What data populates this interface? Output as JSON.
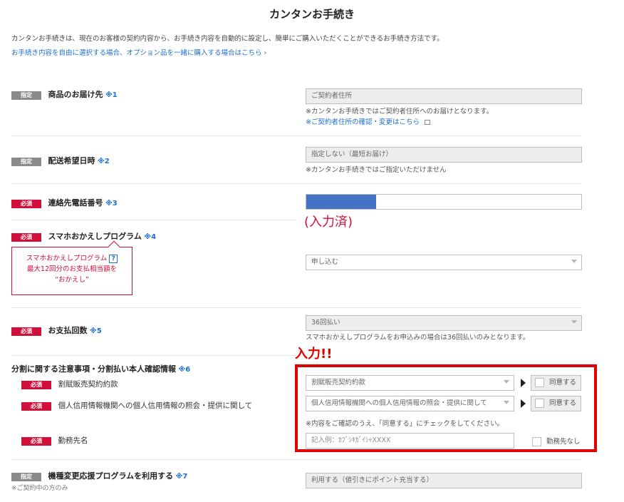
{
  "page": {
    "title": "カンタンお手続き",
    "intro": "カンタンお手続きは、現在のお客様の契約内容から、お手続き内容を自動的に設定し、簡単にご購入いただくことができるお手続き方法です。",
    "intro_link": "お手続き内容を自由に選択する場合、オプション品を一緒に購入する場合はこちら ›"
  },
  "badges": {
    "fixed": "指定",
    "required": "必須"
  },
  "delivery": {
    "label": "商品のお届け先",
    "note": "※1",
    "value": "ご契約者住所",
    "help": "※カンタンお手続きではご契約者住所へのお届けとなります。",
    "link": "※ご契約者住所の確認・変更はこちら"
  },
  "delivery_date": {
    "label": "配送希望日時",
    "note": "※2",
    "value": "指定しない（最短お届け）",
    "help": "※カンタンお手続きではご指定いただけません"
  },
  "phone": {
    "label": "連絡先電話番号",
    "note": "※3",
    "annotation": "(入力済)",
    "filled_color": "#4472c4"
  },
  "kaekae": {
    "label": "スマホおかえしプログラム",
    "note": "※4",
    "promo_line1": "スマホおかえしプログラム",
    "promo_q": "?",
    "promo_line2": "最大12回分のお支払相当額を",
    "promo_line3": "“おかえし”",
    "value": "申し込む"
  },
  "installments": {
    "label": "お支払回数",
    "note": "※5",
    "value": "36回払い",
    "help": "スマホおかえしプログラムをお申込みの場合は36回払いのみとなります。"
  },
  "installment_terms": {
    "annotation": "入力!!",
    "label": "分割に関する注意事項・分割払い本人確認情報",
    "note": "※6",
    "row1_label": "割賦販売契約約款",
    "row1_value": "割賦販売契約約款",
    "row2_label": "個人信用情報機関への個人信用情報の照会・提供に関して",
    "row2_value": "個人信用情報機関への個人信用情報の照会・提供に関して",
    "agree_label": "同意する",
    "help": "※内容をご確認のうえ、「同意する」にチェックをしてください。",
    "row3_label": "勤務先名",
    "row3_placeholder": "記入例：ｶﾌﾞｼｷｶﾞｲｼｬXXXX",
    "no_employer": "勤務先なし"
  },
  "trade_in": {
    "label": "機種変更応援プログラムを利用する",
    "note": "※7",
    "sub": "※ご契約中の方のみ",
    "value": "利用する（値引きにポイント充当する）"
  },
  "colors": {
    "required": "#d0103a",
    "fixed": "#8a8a8a",
    "link": "#1a6fd1",
    "highlight": "#e00000"
  }
}
